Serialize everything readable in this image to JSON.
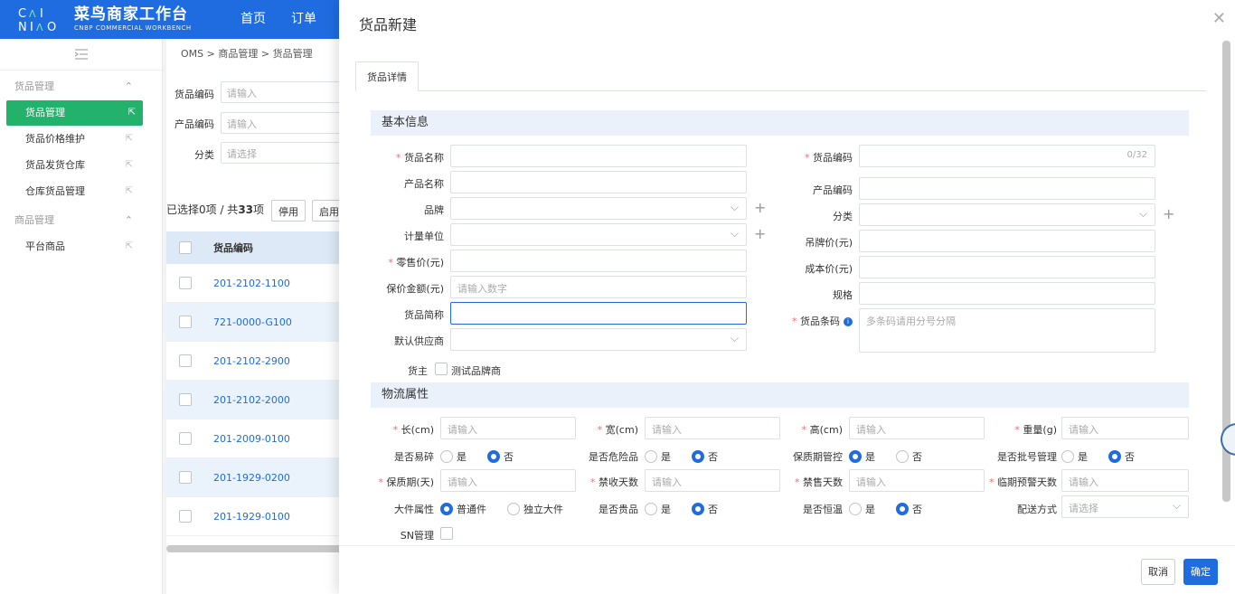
{
  "header": {
    "logo_mark": "CAI NIAO",
    "logo_title": "菜鸟商家工作台",
    "logo_sub": "CNBP COMMERCIAL WORKBENCH",
    "nav": [
      "首页",
      "订单"
    ]
  },
  "sidebar": {
    "groups": [
      {
        "label": "货品管理",
        "items": [
          "货品管理",
          "货品价格维护",
          "货品发货仓库",
          "仓库货品管理"
        ]
      },
      {
        "label": "商品管理",
        "items": [
          "平台商品"
        ]
      }
    ],
    "active": "货品管理"
  },
  "main": {
    "breadcrumb": [
      "OMS",
      "商品管理",
      "货品管理"
    ],
    "filters": [
      {
        "label": "货品编码",
        "placeholder": "请输入"
      },
      {
        "label": "产品编码",
        "placeholder": "请输入"
      },
      {
        "label": "分类",
        "placeholder": "请选择"
      }
    ],
    "selection_prefix": "已选择0项 / 共",
    "selection_count": "33",
    "selection_suffix": "项",
    "buttons": [
      "停用",
      "启用"
    ],
    "table": {
      "header": "货品编码",
      "rows": [
        "201-2102-1100",
        "721-0000-G100",
        "201-2102-2900",
        "201-2102-2000",
        "201-2009-0100",
        "201-1929-0200",
        "201-1929-0100"
      ]
    }
  },
  "drawer": {
    "title": "货品新建",
    "tab": "货品详情",
    "basic_title": "基本信息",
    "basic_left": [
      {
        "label": "货品名称",
        "required": true,
        "value": ""
      },
      {
        "label": "产品名称",
        "required": false,
        "value": ""
      },
      {
        "label": "品牌",
        "required": false,
        "value": ""
      },
      {
        "label": "计量单位",
        "required": false,
        "value": ""
      },
      {
        "label": "零售价(元)",
        "required": true,
        "value": ""
      },
      {
        "label": "保价金额(元)",
        "required": false,
        "placeholder": "请输入数字"
      },
      {
        "label": "货品简称",
        "required": false,
        "value": ""
      },
      {
        "label": "默认供应商",
        "required": false,
        "value": ""
      }
    ],
    "basic_right": [
      {
        "label": "货品编码",
        "required": true,
        "counter": "0/32"
      },
      {
        "label": "产品编码",
        "required": false
      },
      {
        "label": "分类",
        "required": false
      },
      {
        "label": "吊牌价(元)",
        "required": false
      },
      {
        "label": "成本价(元)",
        "required": false
      },
      {
        "label": "规格",
        "required": false
      },
      {
        "label": "货品条码",
        "required": true,
        "placeholder": "多条码请用分号分隔"
      }
    ],
    "owner_label": "货主",
    "owner_option": "测试品牌商",
    "logistics_title": "物流属性",
    "dims": [
      {
        "label": "长(cm)",
        "placeholder": "请输入"
      },
      {
        "label": "宽(cm)",
        "placeholder": "请输入"
      },
      {
        "label": "高(cm)",
        "placeholder": "请输入"
      },
      {
        "label": "重量(g)",
        "placeholder": "请输入"
      }
    ],
    "radios1": [
      {
        "label": "是否易碎",
        "opt1": "是",
        "opt2": "否",
        "selected": 2
      },
      {
        "label": "是否危险品",
        "opt1": "是",
        "opt2": "否",
        "selected": 2
      },
      {
        "label": "保质期管控",
        "opt1": "是",
        "opt2": "否",
        "selected": 1
      },
      {
        "label": "是否批号管理",
        "opt1": "是",
        "opt2": "否",
        "selected": 2
      }
    ],
    "days": [
      {
        "label": "保质期(天)",
        "placeholder": "请输入"
      },
      {
        "label": "禁收天数",
        "placeholder": "请输入"
      },
      {
        "label": "禁售天数",
        "placeholder": "请输入"
      },
      {
        "label": "临期预警天数",
        "placeholder": "请输入"
      }
    ],
    "radios2": [
      {
        "label": "大件属性",
        "opt1": "普通件",
        "opt2": "独立大件",
        "selected": 1
      },
      {
        "label": "是否贵品",
        "opt1": "是",
        "opt2": "否",
        "selected": 2
      },
      {
        "label": "是否恒温",
        "opt1": "是",
        "opt2": "否",
        "selected": 2
      }
    ],
    "delivery_label": "配送方式",
    "delivery_placeholder": "请选择",
    "sn_label": "SN管理",
    "cancel": "取消",
    "confirm": "确定"
  }
}
